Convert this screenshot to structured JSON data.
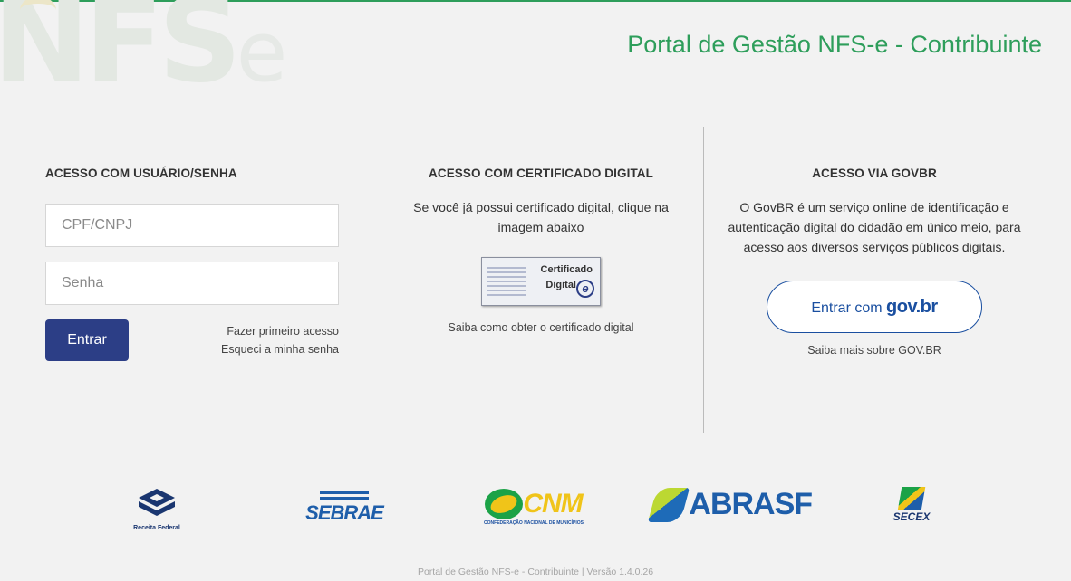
{
  "header": {
    "logo_text": "NFS",
    "logo_suffix": "e",
    "title": "Portal de Gestão NFS-e - Contribuinte",
    "accent_color": "#2e9e5b"
  },
  "login": {
    "heading": "ACESSO COM USUÁRIO/SENHA",
    "cpf_placeholder": "CPF/CNPJ",
    "password_placeholder": "Senha",
    "submit_label": "Entrar",
    "first_access_link": "Fazer primeiro acesso",
    "forgot_password_link": "Esqueci a minha senha",
    "button_color": "#2c3e86"
  },
  "certificate": {
    "heading": "ACESSO COM CERTIFICADO DIGITAL",
    "description": "Se você já possui certificado digital, clique na imagem abaixo",
    "badge_line1": "Certificado",
    "badge_line2": "Digital",
    "badge_icon": "e",
    "info_link": "Saiba como obter o certificado digital"
  },
  "govbr": {
    "heading": "ACESSO VIA GOVBR",
    "description": "O GovBR é um serviço online de identificação e autenticação digital do cidadão em único meio, para acesso aos diversos serviços públicos digitais.",
    "button_prefix": "Entrar com",
    "button_brand": "gov.br",
    "info_link": "Saiba mais sobre GOV.BR"
  },
  "partners": {
    "receita": "Receita Federal",
    "sebrae": "SEBRAE",
    "cnm": "CNM",
    "cnm_sub": "CONFEDERAÇÃO NACIONAL DE MUNICÍPIOS",
    "abrasf": "ABRASF",
    "secex": "SECEX"
  },
  "footer": {
    "text": "Portal de Gestão NFS-e - Contribuinte | Versão 1.4.0.26"
  }
}
